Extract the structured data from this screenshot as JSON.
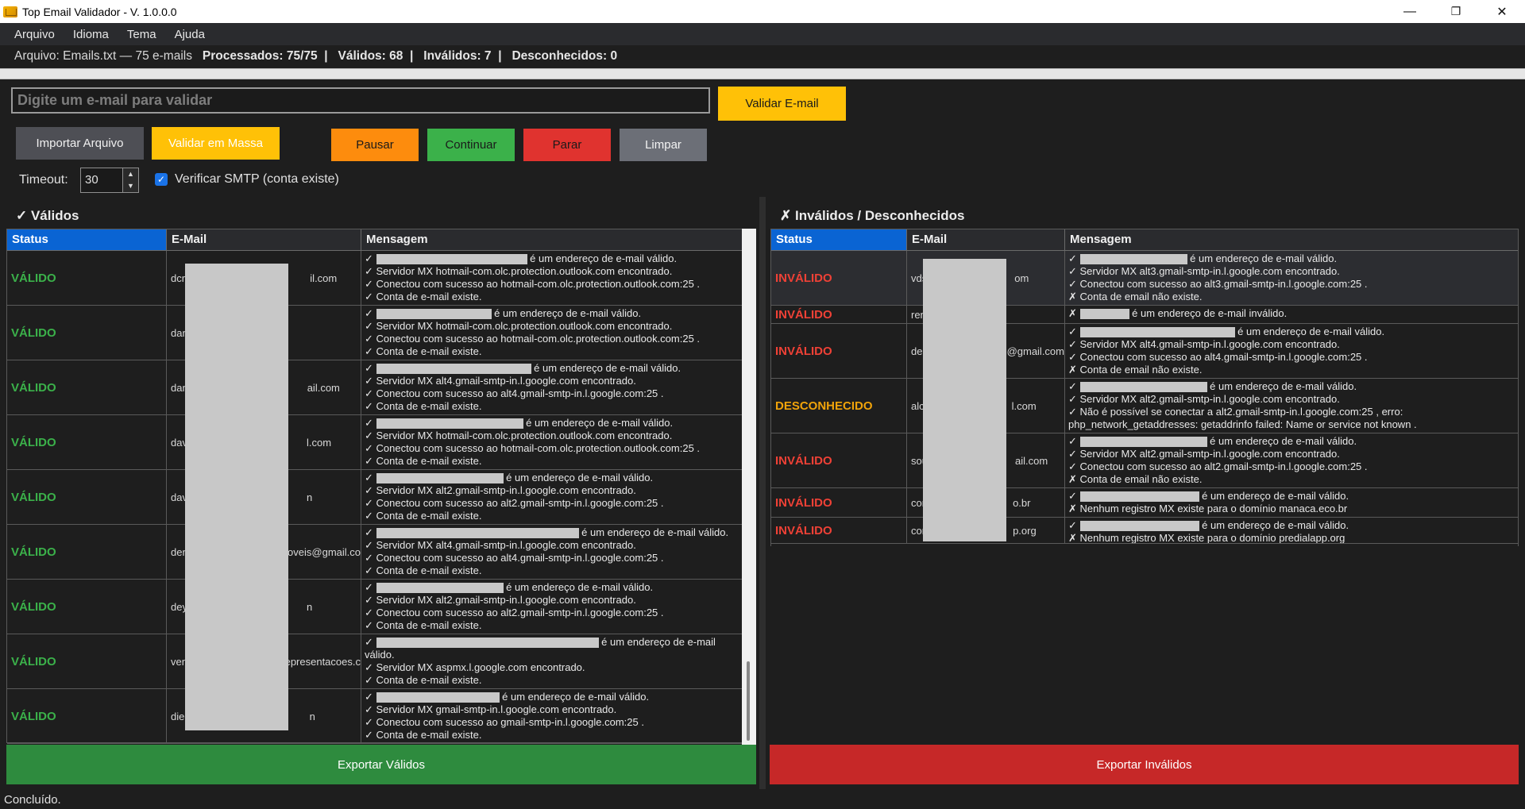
{
  "window": {
    "title": "Top Email Validador - V. 1.0.0.0",
    "minimize": "—",
    "maximize": "❐",
    "close": "✕"
  },
  "menu": [
    "Arquivo",
    "Idioma",
    "Tema",
    "Ajuda"
  ],
  "status": {
    "file": "Arquivo: Emails.txt — 75 e-mails",
    "processed": "Processados: 75/75",
    "valid": "Válidos: 68",
    "invalid": "Inválidos: 7",
    "unknown": "Desconhecidos: 0",
    "sep": "|"
  },
  "progress": {
    "percent": 100
  },
  "email_input": {
    "placeholder": "Digite um e-mail para validar"
  },
  "buttons": {
    "validate_email": "Validar E-mail",
    "import_file": "Importar Arquivo",
    "validate_mass": "Validar em Massa",
    "pause": "Pausar",
    "continue": "Continuar",
    "stop": "Parar",
    "clear": "Limpar",
    "export_valid": "Exportar Válidos",
    "export_invalid": "Exportar Inválidos"
  },
  "options": {
    "timeout_label": "Timeout:",
    "timeout_value": "30",
    "smtp_label": "Verificar SMTP (conta existe)",
    "smtp_checked": true
  },
  "valid_panel": {
    "title": "✓ Válidos",
    "columns": [
      "Status",
      "E-Mail",
      "Mensagem"
    ],
    "rows": [
      {
        "status": "VÁLIDO",
        "email_pre": "dcre",
        "email_post": "il.com",
        "lines": [
          "✓ [r] é um endereço de e-mail válido.",
          "✓ Servidor MX hotmail-com.olc.protection.outlook.com encontrado.",
          "✓ Conectou com sucesso ao hotmail-com.olc.protection.outlook.com:25 .",
          "✓ Conta de e-mail existe."
        ]
      },
      {
        "status": "VÁLIDO",
        "email_pre": "dan",
        "email_post": "",
        "lines": [
          "✓ [r] é um endereço de e-mail válido.",
          "✓ Servidor MX hotmail-com.olc.protection.outlook.com encontrado.",
          "✓ Conectou com sucesso ao hotmail-com.olc.protection.outlook.com:25 .",
          "✓ Conta de e-mail existe."
        ]
      },
      {
        "status": "VÁLIDO",
        "email_pre": "dan",
        "email_post": "ail.com",
        "lines": [
          "✓ [r] é um endereço de e-mail válido.",
          "✓ Servidor MX alt4.gmail-smtp-in.l.google.com encontrado.",
          "✓ Conectou com sucesso ao alt4.gmail-smtp-in.l.google.com:25 .",
          "✓ Conta de e-mail existe."
        ]
      },
      {
        "status": "VÁLIDO",
        "email_pre": "dav",
        "email_post": "l.com",
        "lines": [
          "✓ [r] é um endereço de e-mail válido.",
          "✓ Servidor MX hotmail-com.olc.protection.outlook.com encontrado.",
          "✓ Conectou com sucesso ao hotmail-com.olc.protection.outlook.com:25 .",
          "✓ Conta de e-mail existe."
        ]
      },
      {
        "status": "VÁLIDO",
        "email_pre": "dav",
        "email_post": "n",
        "lines": [
          "✓ [r] é um endereço de e-mail válido.",
          "✓ Servidor MX alt2.gmail-smtp-in.l.google.com encontrado.",
          "✓ Conectou com sucesso ao alt2.gmail-smtp-in.l.google.com:25 .",
          "✓ Conta de e-mail existe."
        ]
      },
      {
        "status": "VÁLIDO",
        "email_pre": "den",
        "email_post": "oveis@gmail.co",
        "lines": [
          "✓ [r] é um endereço de e-mail válido.",
          "✓ Servidor MX alt4.gmail-smtp-in.l.google.com encontrado.",
          "✓ Conectou com sucesso ao alt4.gmail-smtp-in.l.google.com:25 .",
          "✓ Conta de e-mail existe."
        ]
      },
      {
        "status": "VÁLIDO",
        "email_pre": "dey",
        "email_post": "n",
        "lines": [
          "✓ [r] é um endereço de e-mail válido.",
          "✓ Servidor MX alt2.gmail-smtp-in.l.google.com encontrado.",
          "✓ Conectou com sucesso ao alt2.gmail-smtp-in.l.google.com:25 .",
          "✓ Conta de e-mail existe."
        ]
      },
      {
        "status": "VÁLIDO",
        "email_pre": "ven",
        "email_post": "epresentacoes.c",
        "lines": [
          "✓ [r] é um endereço de e-mail",
          "válido.",
          "✓ Servidor MX aspmx.l.google.com encontrado.",
          "✓ Conta de e-mail existe."
        ]
      },
      {
        "status": "VÁLIDO",
        "email_pre": "dieg",
        "email_post": "n",
        "lines": [
          "✓ [r] é um endereço de e-mail válido.",
          "✓ Servidor MX gmail-smtp-in.l.google.com encontrado.",
          "✓ Conectou com sucesso ao gmail-smtp-in.l.google.com:25 .",
          "✓ Conta de e-mail existe."
        ]
      }
    ]
  },
  "invalid_panel": {
    "title": "✗ Inválidos / Desconhecidos",
    "columns": [
      "Status",
      "E-Mail",
      "Mensagem"
    ],
    "rows": [
      {
        "status": "INVÁLIDO",
        "kind": "invalid",
        "email_pre": "vds",
        "email_post": "om",
        "lines": [
          "✓ [r] é um endereço de e-mail válido.",
          "✓ Servidor MX alt3.gmail-smtp-in.l.google.com encontrado.",
          "✓ Conectou com sucesso ao alt3.gmail-smtp-in.l.google.com:25 .",
          "✗ Conta de email não existe."
        ]
      },
      {
        "status": "INVÁLIDO",
        "kind": "invalid",
        "email_pre": "ren",
        "email_post": "",
        "lines": [
          "✗ [r] é um endereço de e-mail inválido."
        ]
      },
      {
        "status": "INVÁLIDO",
        "kind": "invalid",
        "email_pre": "des",
        "email_post": "@gmail.com",
        "lines": [
          "✓ [r] é um endereço de e-mail válido.",
          "✓ Servidor MX alt4.gmail-smtp-in.l.google.com encontrado.",
          "✓ Conectou com sucesso ao alt4.gmail-smtp-in.l.google.com:25 .",
          "✗ Conta de email não existe."
        ]
      },
      {
        "status": "DESCONHECIDO",
        "kind": "unknown",
        "email_pre": "alc",
        "email_post": "l.com",
        "lines": [
          "✓ [r] é um endereço de e-mail válido.",
          "✓ Servidor MX alt2.gmail-smtp-in.l.google.com encontrado.",
          "✓ Não é possível se conectar a alt2.gmail-smtp-in.l.google.com:25 , erro:",
          "php_network_getaddresses: getaddrinfo failed: Name or service not known ."
        ]
      },
      {
        "status": "INVÁLIDO",
        "kind": "invalid",
        "email_pre": "sou",
        "email_post": "ail.com",
        "lines": [
          "✓ [r] é um endereço de e-mail válido.",
          "✓ Servidor MX alt2.gmail-smtp-in.l.google.com encontrado.",
          "✓ Conectou com sucesso ao alt2.gmail-smtp-in.l.google.com:25 .",
          "✗ Conta de email não existe."
        ]
      },
      {
        "status": "INVÁLIDO",
        "kind": "invalid",
        "email_pre": "cor",
        "email_post": "o.br",
        "lines": [
          "✓ [r] é um endereço de e-mail válido.",
          "✗ Nenhum registro MX existe para o domínio manaca.eco.br"
        ]
      },
      {
        "status": "INVÁLIDO",
        "kind": "invalid",
        "email_pre": "cor",
        "email_post": "p.org",
        "lines": [
          "✓ [r] é um endereço de e-mail válido.",
          "✗ Nenhum registro MX existe para o domínio predialapp.org"
        ]
      }
    ]
  },
  "footer": "Concluído.",
  "colors": {
    "accent": "#0a64d3",
    "valid": "#3bb14a",
    "invalid": "#ef4136",
    "unknown": "#f0a30a",
    "export_valid": "#2e8b3e",
    "export_invalid": "#c62828"
  }
}
